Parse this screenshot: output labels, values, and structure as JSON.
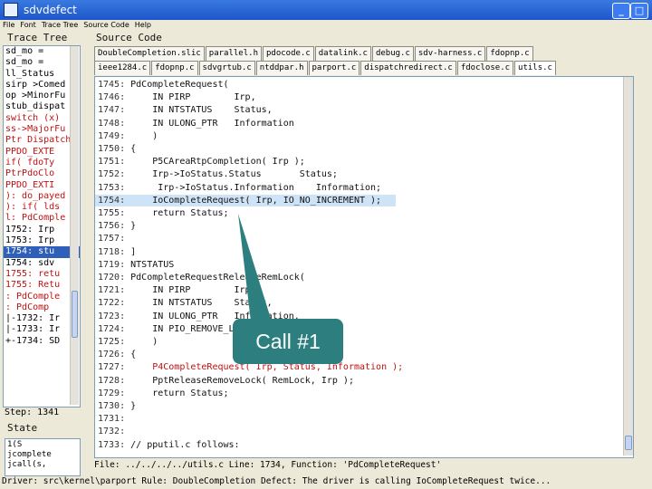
{
  "window": {
    "title": "sdvdefect",
    "min": "_",
    "max": "□",
    "close": "x"
  },
  "menu": [
    "File",
    "Font",
    "Trace Tree",
    "Source Code",
    "Help"
  ],
  "trace_tree": {
    "label": "Trace Tree",
    "rows": [
      {
        "text": "sd_mo =",
        "style": ""
      },
      {
        "text": "sd_mo =",
        "style": ""
      },
      {
        "text": "ll_Status",
        "style": ""
      },
      {
        "text": "sirp >Comed",
        "style": ""
      },
      {
        "text": "op >MinorFu",
        "style": ""
      },
      {
        "text": "stub_dispat",
        "style": ""
      },
      {
        "text": "switch (x)",
        "style": "red"
      },
      {
        "text": "ss->MajorFu",
        "style": "red"
      },
      {
        "text": "Ptr Dispatch",
        "style": "red"
      },
      {
        "text": " PPDO_EXTE",
        "style": "red"
      },
      {
        "text": " if( fdoTy",
        "style": "red"
      },
      {
        "text": " PtrPdoClo",
        "style": "red"
      },
      {
        "text": " PPDO_EXTI",
        "style": "red"
      },
      {
        "text": "): do_payed",
        "style": "red"
      },
      {
        "text": "): if( lds",
        "style": "red"
      },
      {
        "text": "l: PdComple",
        "style": "red"
      },
      {
        "text": " 1752: Irp",
        "style": ""
      },
      {
        "text": " 1753: Irp",
        "style": ""
      },
      {
        "text": " 1754: stu",
        "style": "sel"
      },
      {
        "text": " 1754: sdv",
        "style": ""
      },
      {
        "text": " 1755: retu",
        "style": "red"
      },
      {
        "text": " 1755: Retu",
        "style": "red"
      },
      {
        "text": ": PdComple",
        "style": "red"
      },
      {
        "text": ": PdComp",
        "style": "red"
      },
      {
        "text": " |-1732: Ir",
        "style": ""
      },
      {
        "text": " |-1733: Ir",
        "style": ""
      },
      {
        "text": " +-1734: SD",
        "style": ""
      }
    ]
  },
  "step": "Step: 1341",
  "state": {
    "label": "State",
    "lines": [
      "1(S",
      "jcomplete",
      "jcall(s,"
    ]
  },
  "source": {
    "label": "Source Code",
    "tabs_row1": [
      "DoubleCompletion.slic",
      "parallel.h",
      "pdocode.c",
      "datalink.c",
      "debug.c",
      "sdv-harness.c",
      "fdopnp.c"
    ],
    "tabs_row2": [
      "ieee1284.c",
      "fdopnp.c",
      "sdvgrtub.c",
      "ntddpar.h",
      "parport.c",
      "dispatchredirect.c",
      "fdoclose.c",
      "utils.c"
    ],
    "lines": [
      {
        "n": "1745:",
        "t": " PdCompleteRequest(",
        "style": ""
      },
      {
        "n": "1746:",
        "t": "     IN PIRP        Irp,",
        "style": ""
      },
      {
        "n": "1747:",
        "t": "     IN NTSTATUS    Status,",
        "style": ""
      },
      {
        "n": "1748:",
        "t": "     IN ULONG_PTR   Information",
        "style": ""
      },
      {
        "n": "1749:",
        "t": "     )",
        "style": ""
      },
      {
        "n": "1750:",
        "t": " {",
        "style": ""
      },
      {
        "n": "1751:",
        "t": "     P5CAreaRtpCompletion( Irp );",
        "style": ""
      },
      {
        "n": "1752:",
        "t": "     Irp->IoStatus.Status       Status;",
        "style": ""
      },
      {
        "n": "1753:",
        "t": "      Irp->IoStatus.Information    Information;",
        "style": ""
      },
      {
        "n": "1754:",
        "t": "     IoCompleteRequest( Irp, IO_NO_INCREMENT );",
        "style": "hl"
      },
      {
        "n": "1755:",
        "t": "     return Status;",
        "style": ""
      },
      {
        "n": "1756:",
        "t": " }",
        "style": ""
      },
      {
        "n": "1757:",
        "t": "",
        "style": ""
      },
      {
        "n": "1718:",
        "t": " ]",
        "style": ""
      },
      {
        "n": "1719:",
        "t": " NTSTATUS",
        "style": ""
      },
      {
        "n": "1720:",
        "t": " PdCompleteRequestReleaseRemLock(",
        "style": ""
      },
      {
        "n": "1721:",
        "t": "     IN PIRP        Irp,",
        "style": ""
      },
      {
        "n": "1722:",
        "t": "     IN NTSTATUS    Status,",
        "style": ""
      },
      {
        "n": "1723:",
        "t": "     IN ULONG_PTR   Information,",
        "style": ""
      },
      {
        "n": "1724:",
        "t": "     IN PIO_REMOVE_LOCK",
        "style": ""
      },
      {
        "n": "1725:",
        "t": "     )",
        "style": ""
      },
      {
        "n": "1726:",
        "t": " {",
        "style": ""
      },
      {
        "n": "1727:",
        "t": "     P4CompleteRequest( Irp, Status, Information );",
        "style": "red"
      },
      {
        "n": "1728:",
        "t": "     PptReleaseRemoveLock( RemLock, Irp );",
        "style": ""
      },
      {
        "n": "1729:",
        "t": "     return Status;",
        "style": ""
      },
      {
        "n": "1730:",
        "t": " }",
        "style": ""
      },
      {
        "n": "1731:",
        "t": "",
        "style": ""
      },
      {
        "n": "1732:",
        "t": "",
        "style": ""
      },
      {
        "n": "1733:",
        "t": " // pputil.c follows:",
        "style": ""
      }
    ]
  },
  "status": {
    "line1": "File: ../../../../utils.c    Line: 1734,   Function: 'PdCompleteRequest'",
    "line2": "Driver: src\\kernel\\parport    Rule: DoubleCompletion    Defect: The driver is calling IoCompleteRequest twice..."
  },
  "callout": "Call #1",
  "colors": {
    "callout": "#2d7f7f",
    "highlight": "#cfe3f7",
    "error_red": "#c01010",
    "selection": "#2f5fb8"
  }
}
